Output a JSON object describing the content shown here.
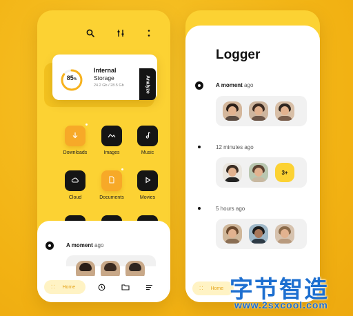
{
  "left_phone": {
    "toolbar_icons": [
      "search-icon",
      "filter-icon",
      "more-icon"
    ],
    "storage": {
      "percent": "85",
      "percent_sign": "%",
      "progress_fraction": 0.85,
      "title": "Internal",
      "subtitle": "Storage",
      "meta": "24.2 Gb / 28.5 Gb",
      "analyze_label": "Analyze"
    },
    "tiles": [
      {
        "label": "Downloads",
        "icon": "download-icon",
        "style": "orange"
      },
      {
        "label": "Images",
        "icon": "image-icon",
        "style": "dark"
      },
      {
        "label": "Music",
        "icon": "music-icon",
        "style": "dark"
      },
      {
        "label": "Cloud",
        "icon": "cloud-icon",
        "style": "dark"
      },
      {
        "label": "Documents",
        "icon": "document-icon",
        "style": "orange"
      },
      {
        "label": "Movies",
        "icon": "play-icon",
        "style": "dark"
      }
    ],
    "sheet": {
      "moment_bold": "A moment",
      "moment_rest": " ago"
    },
    "navbar": {
      "home_label": "Home",
      "icons": [
        "clock-icon",
        "folder-icon",
        "menu-icon"
      ]
    }
  },
  "right_phone": {
    "title": "Logger",
    "entries": [
      {
        "time_bold": "A moment",
        "time_rest": " ago"
      },
      {
        "time_bold": "",
        "time_rest": "12 minutes ago"
      },
      {
        "time_bold": "",
        "time_rest": "5 hours ago"
      }
    ],
    "more_count": "3+",
    "navbar": {
      "home_label": "Home"
    }
  },
  "watermark": {
    "chinese": "字节智造",
    "url": "www.2sxcool.com"
  },
  "colors": {
    "background": "#f5b915",
    "phone": "#fcd233",
    "accent_orange": "#f7a928",
    "dark": "#151515",
    "watermark_blue": "#1d6fd0"
  }
}
